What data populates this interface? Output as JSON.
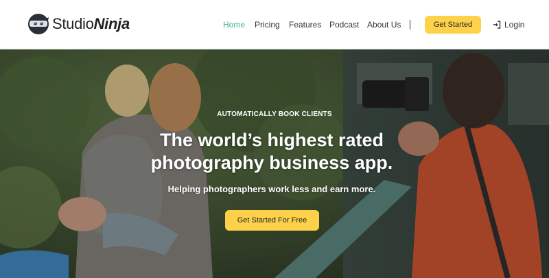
{
  "brand": {
    "name_part1": "Studio",
    "name_part2": "Ninja",
    "logo_icon": "ninja-logo-icon"
  },
  "nav": {
    "items": [
      {
        "label": "Home",
        "active": true
      },
      {
        "label": "Pricing",
        "active": false
      },
      {
        "label": "Features",
        "active": false
      },
      {
        "label": "Podcast",
        "active": false
      },
      {
        "label": "About Us",
        "active": false
      }
    ],
    "cta_label": "Get Started",
    "login_label": "Login",
    "login_icon": "sign-in-icon"
  },
  "hero": {
    "eyebrow": "AUTOMATICALLY BOOK CLIENTS",
    "headline_line1": "The world’s highest rated",
    "headline_line2": "photography business app.",
    "subline": "Helping photographers work less and earn more.",
    "cta_label": "Get Started For Free",
    "background": "photo of a mother holding a child being photographed by a photographer in a garden"
  },
  "colors": {
    "accent": "#fdd24a",
    "active_nav": "#3fae96",
    "text": "#333333"
  }
}
